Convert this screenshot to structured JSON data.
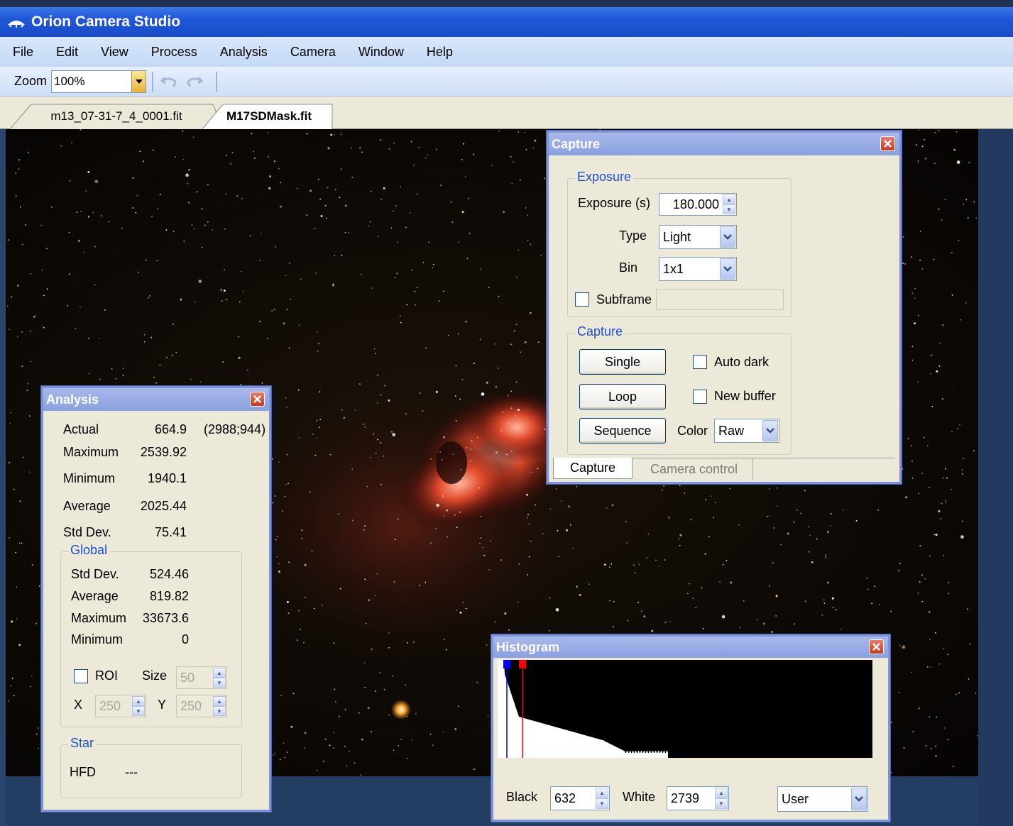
{
  "window": {
    "title": "Orion Camera Studio"
  },
  "menu": [
    "File",
    "Edit",
    "View",
    "Process",
    "Analysis",
    "Camera",
    "Window",
    "Help"
  ],
  "toolbar": {
    "zoom_label": "Zoom",
    "zoom_value": "100%"
  },
  "tabs": [
    {
      "label": "m13_07-31-7_4_0001.fit",
      "active": false
    },
    {
      "label": "M17SDMask.fit",
      "active": true
    }
  ],
  "analysis": {
    "title": "Analysis",
    "actual_label": "Actual",
    "actual_value": "664.9",
    "actual_coords": "(2988;944)",
    "maximum_label": "Maximum",
    "maximum_value": "2539.92",
    "minimum_label": "Minimum",
    "minimum_value": "1940.1",
    "average_label": "Average",
    "average_value": "2025.44",
    "stddev_label": "Std Dev.",
    "stddev_value": "75.41",
    "global": {
      "label": "Global",
      "stddev_label": "Std Dev.",
      "stddev_value": "524.46",
      "average_label": "Average",
      "average_value": "819.82",
      "maximum_label": "Maximum",
      "maximum_value": "33673.6",
      "minimum_label": "Minimum",
      "minimum_value": "0"
    },
    "roi_label": "ROI",
    "size_label": "Size",
    "size_value": "50",
    "x_label": "X",
    "x_value": "250",
    "y_label": "Y",
    "y_value": "250",
    "star": {
      "label": "Star",
      "hfd_label": "HFD",
      "hfd_value": "---"
    }
  },
  "capture": {
    "title": "Capture",
    "exposure_group": "Exposure",
    "exposure_label": "Exposure (s)",
    "exposure_value": "180.000",
    "type_label": "Type",
    "type_value": "Light",
    "bin_label": "Bin",
    "bin_value": "1x1",
    "subframe_label": "Subframe",
    "capture_group": "Capture",
    "single_label": "Single",
    "loop_label": "Loop",
    "sequence_label": "Sequence",
    "auto_dark_label": "Auto dark",
    "new_buffer_label": "New buffer",
    "color_label": "Color",
    "color_value": "Raw",
    "tabs": [
      "Capture",
      "Camera control"
    ]
  },
  "histogram": {
    "title": "Histogram",
    "black_label": "Black",
    "black_value": "632",
    "white_label": "White",
    "white_value": "2739",
    "mode_value": "User",
    "colors": {
      "black_marker": "#0000ff",
      "white_marker": "#ff0000"
    }
  }
}
